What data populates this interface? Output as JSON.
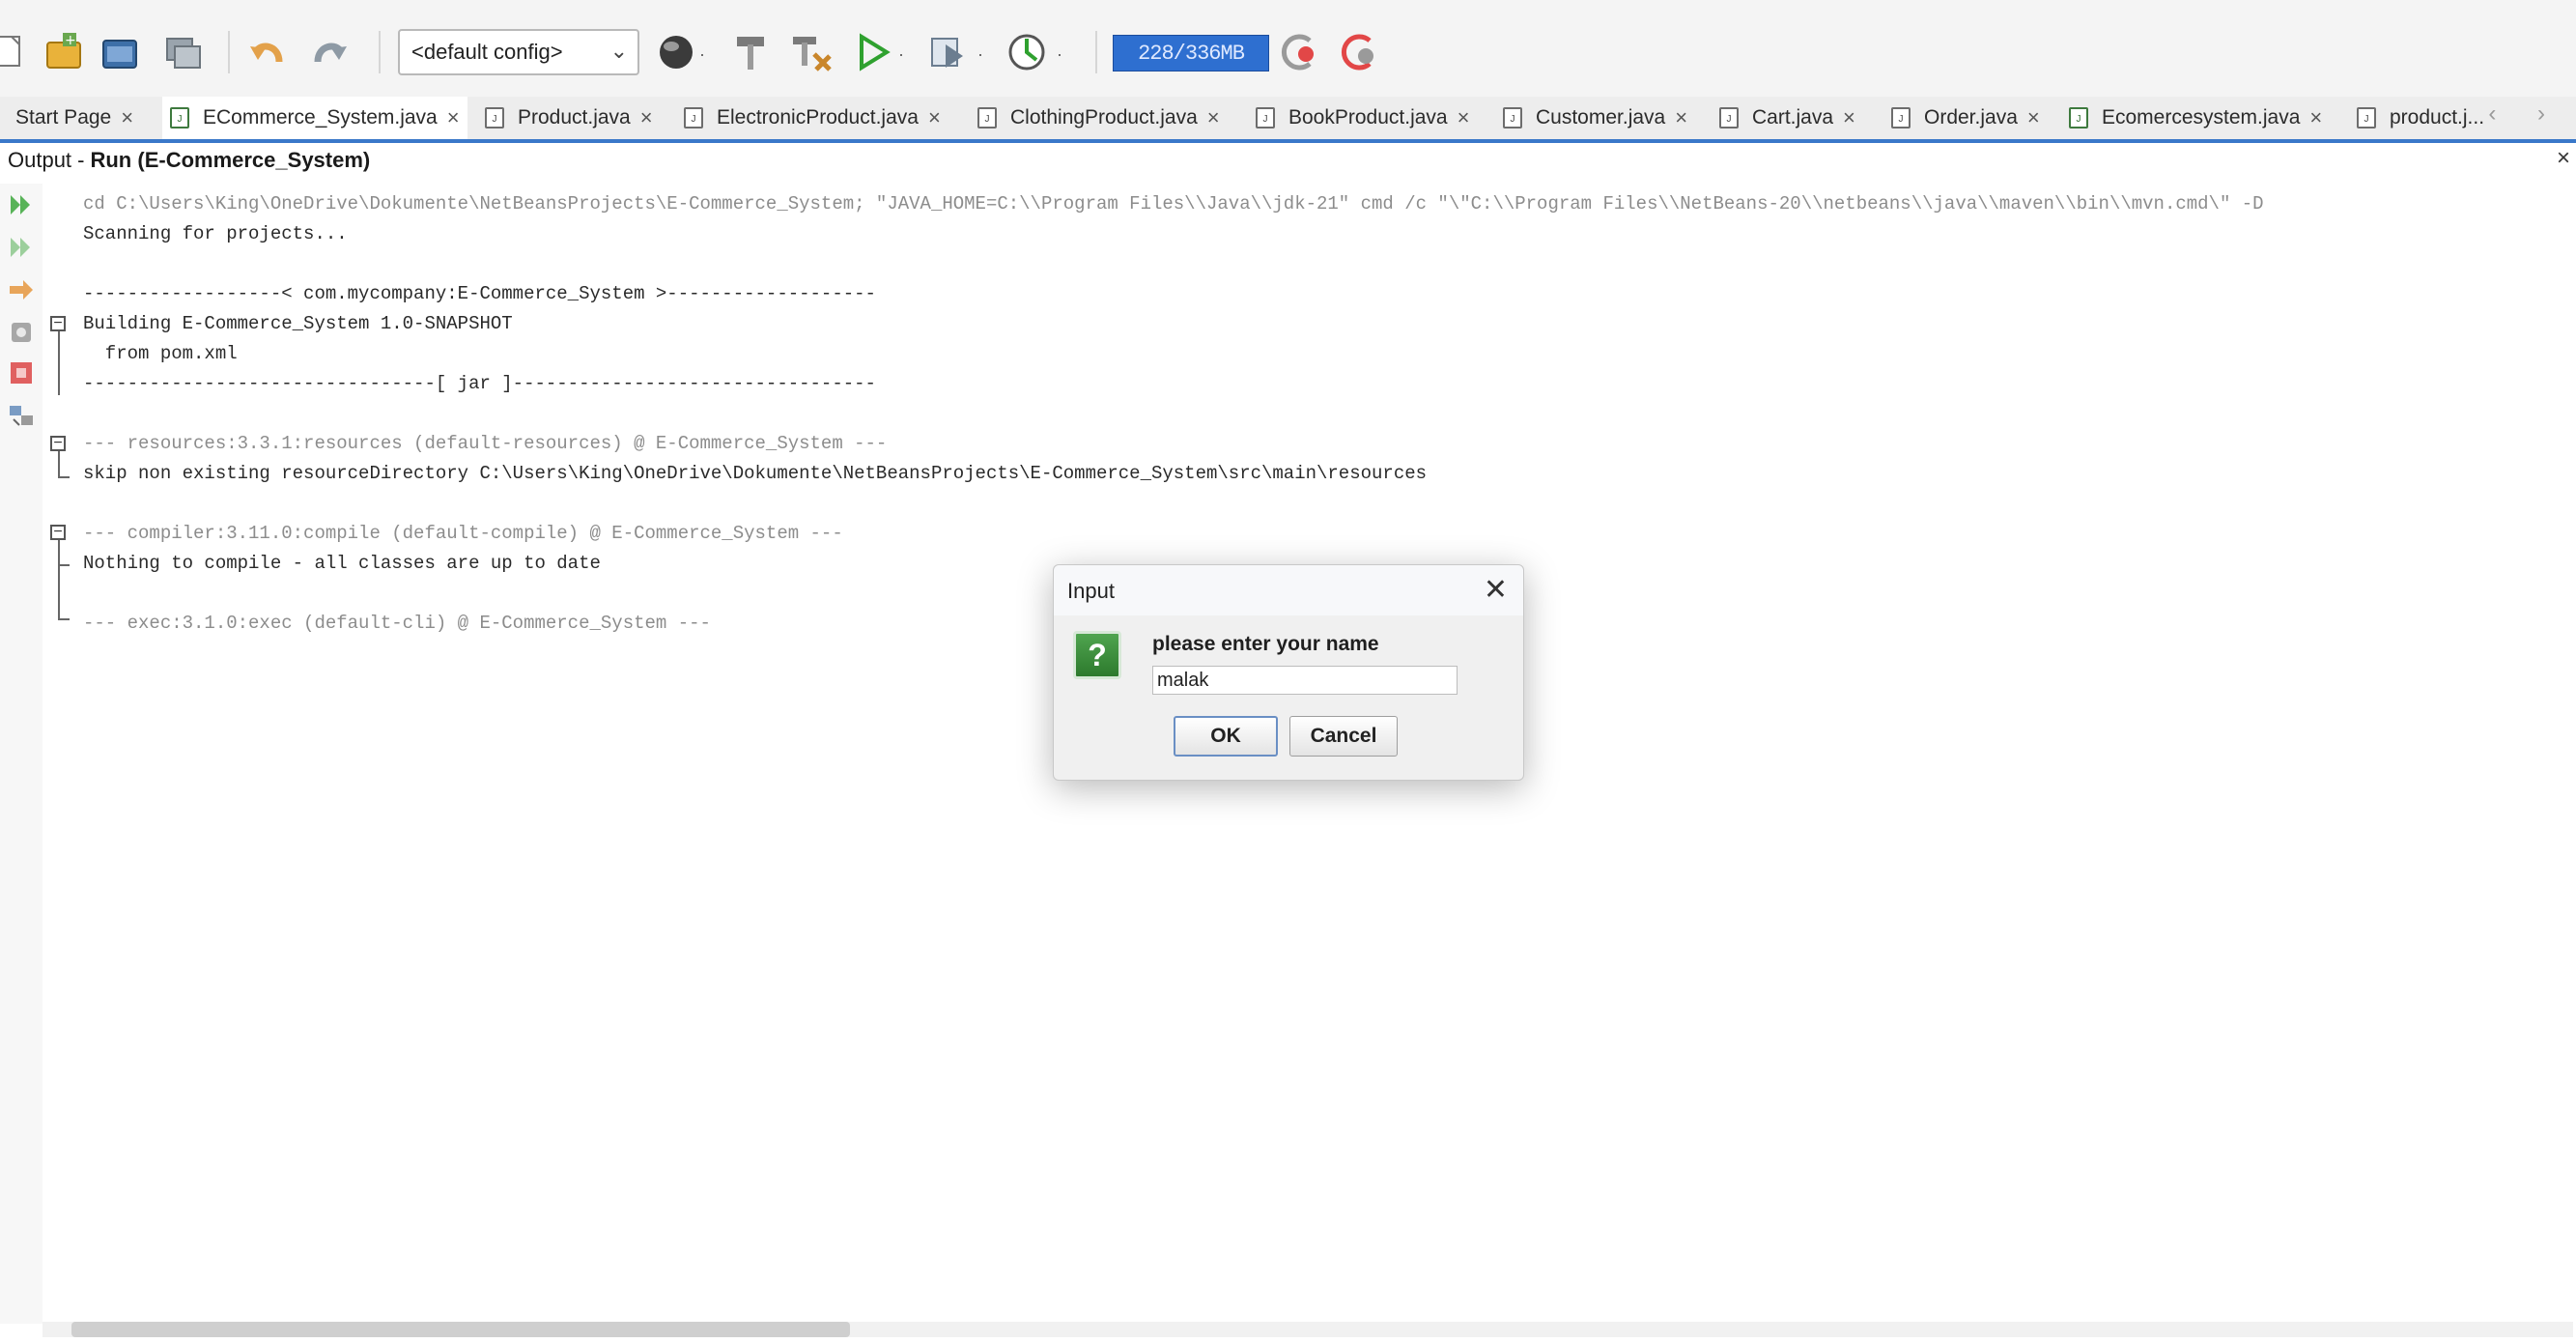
{
  "toolbar": {
    "config_select": "<default config>",
    "memory_indicator": "228/336MB",
    "icons": [
      "new-file-icon",
      "new-project-icon",
      "open-project-icon",
      "close-project-icon",
      "undo-icon",
      "redo-icon",
      "globe-icon",
      "build-hammer-icon",
      "clean-build-icon",
      "run-icon",
      "debug-icon",
      "profile-icon",
      "gc-icon",
      "gc-alt-icon"
    ]
  },
  "tabs": [
    {
      "label": "Start Page",
      "active": false
    },
    {
      "label": "ECommerce_System.java",
      "active": true
    },
    {
      "label": "Product.java",
      "active": false
    },
    {
      "label": "ElectronicProduct.java",
      "active": false
    },
    {
      "label": "ClothingProduct.java",
      "active": false
    },
    {
      "label": "BookProduct.java",
      "active": false
    },
    {
      "label": "Customer.java",
      "active": false
    },
    {
      "label": "Cart.java",
      "active": false
    },
    {
      "label": "Order.java",
      "active": false
    },
    {
      "label": "Ecomercesystem.java",
      "active": false
    },
    {
      "label": "product.j...",
      "active": false
    }
  ],
  "tab_close": "×",
  "tab_scroll": "‹ ›",
  "output": {
    "prefix": "Output -",
    "title": "Run (E-Commerce_System)",
    "close": "×"
  },
  "console_lines": [
    {
      "text": "cd C:\\Users\\King\\OneDrive\\Dokumente\\NetBeansProjects\\E-Commerce_System; \"JAVA_HOME=C:\\\\Program Files\\\\Java\\\\jdk-21\" cmd /c \"\\\"C:\\\\Program Files\\\\NetBeans-20\\\\netbeans\\\\java\\\\maven\\\\bin\\\\mvn.cmd\\\" -D",
      "style": "gray"
    },
    {
      "text": "Scanning for projects...",
      "style": "normal"
    },
    {
      "text": "",
      "style": "normal"
    },
    {
      "text": "------------------< com.mycompany:E-Commerce_System >-------------------",
      "style": "normal"
    },
    {
      "text": "Building E-Commerce_System 1.0-SNAPSHOT",
      "style": "normal"
    },
    {
      "text": "  from pom.xml",
      "style": "normal"
    },
    {
      "text": "--------------------------------[ jar ]---------------------------------",
      "style": "normal"
    },
    {
      "text": "",
      "style": "normal"
    },
    {
      "text": "--- resources:3.3.1:resources (default-resources) @ E-Commerce_System ---",
      "style": "gray"
    },
    {
      "text": "skip non existing resourceDirectory C:\\Users\\King\\OneDrive\\Dokumente\\NetBeansProjects\\E-Commerce_System\\src\\main\\resources",
      "style": "normal"
    },
    {
      "text": "",
      "style": "normal"
    },
    {
      "text": "--- compiler:3.11.0:compile (default-compile) @ E-Commerce_System ---",
      "style": "gray"
    },
    {
      "text": "Nothing to compile - all classes are up to date",
      "style": "normal"
    },
    {
      "text": "",
      "style": "normal"
    },
    {
      "text": "--- exec:3.1.0:exec (default-cli) @ E-Commerce_System ---",
      "style": "gray"
    }
  ],
  "dialog": {
    "title": "Input",
    "close": "✕",
    "icon": "?",
    "prompt": "please enter your name",
    "input_value": "malak",
    "ok_label": "OK",
    "cancel_label": "Cancel"
  },
  "colors": {
    "accent": "#3a78c9",
    "memory_bar": "#2e6fd0",
    "question_icon": "#3d8f3d"
  }
}
